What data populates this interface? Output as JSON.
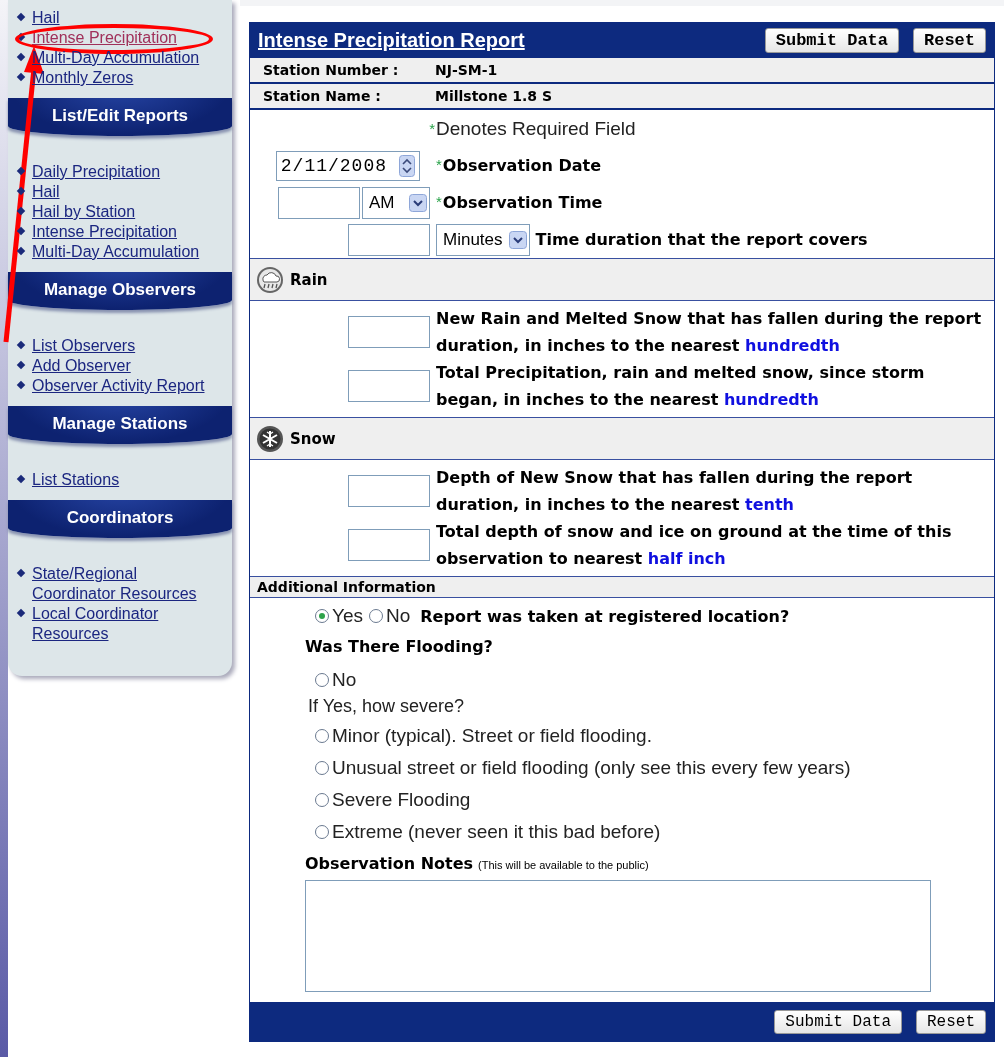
{
  "sidebar": {
    "top_links": [
      {
        "label": "Hail",
        "visited": false,
        "circled": false
      },
      {
        "label": "Intense Precipitation",
        "visited": true,
        "circled": true
      },
      {
        "label": "Multi-Day Accumulation",
        "visited": false,
        "circled": false
      },
      {
        "label": "Monthly Zeros",
        "visited": false,
        "circled": false
      }
    ],
    "sections": [
      {
        "title": "List/Edit Reports",
        "links": [
          "Daily Precipitation",
          "Hail",
          "Hail by Station",
          "Intense Precipitation",
          "Multi-Day Accumulation"
        ]
      },
      {
        "title": "Manage Observers",
        "links": [
          "List Observers",
          "Add Observer",
          "Observer Activity Report"
        ]
      },
      {
        "title": "Manage Stations",
        "links": [
          "List Stations"
        ]
      },
      {
        "title": "Coordinators",
        "links": [
          "State/Regional Coordinator Resources",
          "Local Coordinator Resources"
        ]
      }
    ]
  },
  "form": {
    "title": "Intense Precipitation Report",
    "buttons": [
      "Submit Data",
      "Reset"
    ],
    "station": [
      {
        "label": "Station Number :",
        "value": "NJ-SM-1"
      },
      {
        "label": "Station Name :",
        "value": "Millstone 1.8 S"
      }
    ],
    "required_note": {
      "mark": "*",
      "text": "Denotes Required Field"
    },
    "date": {
      "value": "2/11/2008",
      "required": true,
      "label": "Observation Date"
    },
    "time": {
      "ampm": "AM",
      "required": true,
      "label": "Observation Time"
    },
    "duration": {
      "unit": "Minutes",
      "label": "Time duration that the report covers"
    },
    "sections": [
      {
        "title": "Rain",
        "kind": "rain",
        "fields": [
          {
            "text": "New Rain and Melted Snow that has fallen during the report duration, in inches to the nearest",
            "unit": "hundredth"
          },
          {
            "text": "Total Precipitation, rain and melted snow, since storm began, in inches to the nearest",
            "unit": "hundredth"
          }
        ]
      },
      {
        "title": "Snow",
        "kind": "snow",
        "fields": [
          {
            "text": "Depth of New Snow that has fallen during the report duration, in inches to the nearest",
            "unit": "tenth"
          },
          {
            "text": "Total depth of snow and ice on ground at the time of this observation to nearest",
            "unit": "half inch"
          }
        ]
      }
    ],
    "additional": {
      "title": "Additional Information",
      "location": {
        "options": [
          {
            "label": "Yes",
            "selected": true
          },
          {
            "label": "No",
            "selected": false
          }
        ],
        "question": "Report was taken at registered location?"
      },
      "flooding": {
        "title": "Was There Flooding?",
        "no_option": {
          "label": "No",
          "selected": false
        },
        "prompt": "If Yes, how severe?",
        "options": [
          {
            "label": "Minor (typical). Street or field flooding.",
            "selected": false
          },
          {
            "label": "Unusual street or field flooding (only see this every few years)",
            "selected": false
          },
          {
            "label": "Severe Flooding",
            "selected": false
          },
          {
            "label": "Extreme (never seen it this bad before)",
            "selected": false
          }
        ]
      },
      "notes": {
        "label": "Observation Notes",
        "hint": "(This will be available to the public)"
      }
    },
    "footer_buttons": [
      "Submit Data",
      "Reset"
    ]
  }
}
